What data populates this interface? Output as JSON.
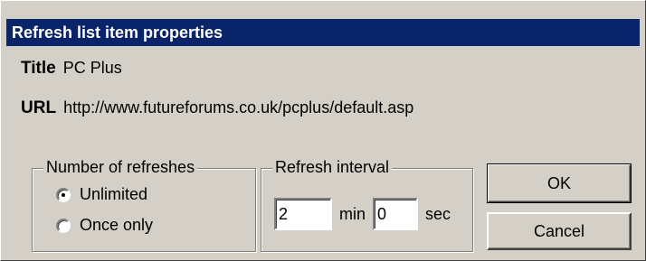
{
  "dialog": {
    "title": "Refresh list item properties"
  },
  "fields": {
    "title_label": "Title",
    "title_value": "PC Plus",
    "url_label": "URL",
    "url_value": "http://www.futureforums.co.uk/pcplus/default.asp"
  },
  "refreshes": {
    "group_label": "Number of refreshes",
    "options": [
      {
        "label": "Unlimited",
        "checked": true
      },
      {
        "label": "Once only",
        "checked": false
      }
    ]
  },
  "interval": {
    "group_label": "Refresh interval",
    "minutes_value": "2",
    "minutes_unit": "min",
    "seconds_value": "0",
    "seconds_unit": "sec"
  },
  "buttons": {
    "ok_label": "OK",
    "cancel_label": "Cancel"
  },
  "colors": {
    "titlebar": "#0a246a",
    "dialog_face": "#d4d0c8"
  }
}
